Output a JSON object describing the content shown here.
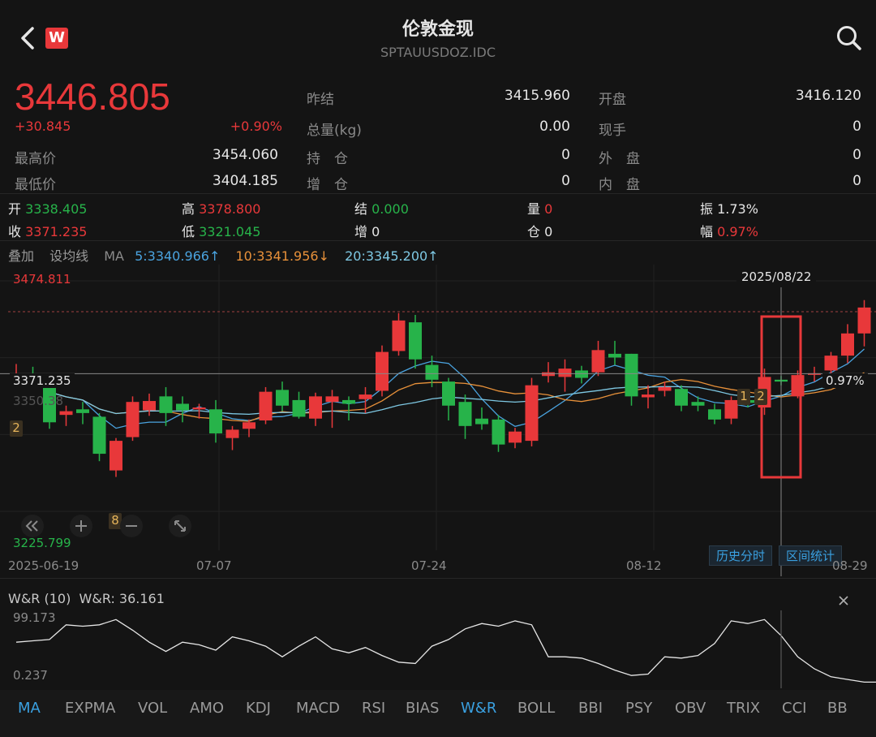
{
  "header": {
    "title": "伦敦金现",
    "subtitle": "SPTAUUSDOZ.IDC",
    "back_icon": "chevron-left-icon",
    "app_icon": "wps-logo-icon",
    "search_icon": "search-icon"
  },
  "quote": {
    "price": "3446.805",
    "change": "+30.845",
    "change_pct": "+0.90%",
    "prev_settle_label": "昨结",
    "prev_settle": "3415.960",
    "open_label": "开盘",
    "open": "3416.120",
    "volume_label": "总量(kg)",
    "volume": "0.00",
    "current_hand_label": "现手",
    "current_hand": "0",
    "high_label": "最高价",
    "high": "3454.060",
    "position_label": "持　仓",
    "position": "0",
    "outer_label": "外　盘",
    "outer": "0",
    "low_label": "最低价",
    "low": "3404.185",
    "increase_label": "增　仓",
    "increase": "0",
    "inner_label": "内　盘",
    "inner": "0"
  },
  "ohlc": {
    "open_label": "开",
    "open": "3338.405",
    "high_label": "高",
    "high": "3378.800",
    "settle_label": "结",
    "settle": "0.000",
    "vol_label": "量",
    "vol": "0",
    "amp_label": "振",
    "amp": "1.73%",
    "close_label": "收",
    "close": "3371.235",
    "low_label": "低",
    "low": "3321.045",
    "inc_label": "增",
    "inc": "0",
    "pos_label": "仓",
    "pos": "0",
    "range_label": "幅",
    "range": "0.97%"
  },
  "ma_bar": {
    "overlay": "叠加",
    "set_ma": "设均线",
    "ma": "MA",
    "ma5": "5:3340.966↑",
    "ma10": "10:3341.956↓",
    "ma20": "20:3345.200↑"
  },
  "chart_labels": {
    "max_price": "3474.811",
    "min_price": "3225.799",
    "crosshair_date": "2025/08/22",
    "crosshair_price": "3371.235",
    "crosshair_pct": "0.97%",
    "overlap_price": "3350.38",
    "badge_2_left": "2",
    "badge_8": "8",
    "badge_1": "1",
    "badge_2_right": "2",
    "history_btn": "历史分时",
    "stats_btn": "区间统计",
    "x_ticks": [
      "2025-06-19",
      "07-07",
      "07-24",
      "08-12",
      "08-29"
    ]
  },
  "colors": {
    "up": "#e8383a",
    "down": "#27b34a",
    "ma5": "#4aa3df",
    "ma10": "#e8913a",
    "ma20": "#7ec8e3",
    "accent": "#3aa0e0"
  },
  "chart_data": {
    "type": "candlestick",
    "ylim": [
      3225.799,
      3474.811
    ],
    "x": [
      "2025-06-19",
      "06-20",
      "06-23",
      "06-24",
      "06-25",
      "06-26",
      "06-27",
      "06-30",
      "07-01",
      "07-02",
      "07-03",
      "07-04",
      "07-07",
      "07-08",
      "07-09",
      "07-10",
      "07-11",
      "07-14",
      "07-15",
      "07-16",
      "07-17",
      "07-18",
      "07-21",
      "07-22",
      "07-23",
      "07-24",
      "07-25",
      "07-28",
      "07-29",
      "07-30",
      "07-31",
      "08-01",
      "08-04",
      "08-05",
      "08-06",
      "08-07",
      "08-08",
      "08-11",
      "08-12",
      "08-13",
      "08-14",
      "08-15",
      "08-18",
      "08-19",
      "08-20",
      "08-21",
      "08-22",
      "08-25",
      "08-26",
      "08-27",
      "08-28",
      "08-29"
    ],
    "candles": [
      {
        "o": 3368,
        "h": 3385,
        "l": 3360,
        "c": 3372
      },
      {
        "o": 3372,
        "h": 3382,
        "l": 3366,
        "c": 3370
      },
      {
        "o": 3360,
        "h": 3368,
        "l": 3315,
        "c": 3322
      },
      {
        "o": 3330,
        "h": 3340,
        "l": 3318,
        "c": 3334
      },
      {
        "o": 3336,
        "h": 3344,
        "l": 3320,
        "c": 3332
      },
      {
        "o": 3328,
        "h": 3332,
        "l": 3280,
        "c": 3288
      },
      {
        "o": 3270,
        "h": 3305,
        "l": 3263,
        "c": 3302
      },
      {
        "o": 3306,
        "h": 3350,
        "l": 3302,
        "c": 3344
      },
      {
        "o": 3335,
        "h": 3353,
        "l": 3329,
        "c": 3345
      },
      {
        "o": 3350,
        "h": 3360,
        "l": 3318,
        "c": 3332
      },
      {
        "o": 3342,
        "h": 3350,
        "l": 3322,
        "c": 3335
      },
      {
        "o": 3336,
        "h": 3342,
        "l": 3326,
        "c": 3338
      },
      {
        "o": 3336,
        "h": 3346,
        "l": 3300,
        "c": 3310
      },
      {
        "o": 3305,
        "h": 3318,
        "l": 3292,
        "c": 3314
      },
      {
        "o": 3315,
        "h": 3325,
        "l": 3306,
        "c": 3322
      },
      {
        "o": 3324,
        "h": 3360,
        "l": 3320,
        "c": 3355
      },
      {
        "o": 3357,
        "h": 3366,
        "l": 3334,
        "c": 3340
      },
      {
        "o": 3346,
        "h": 3355,
        "l": 3326,
        "c": 3328
      },
      {
        "o": 3326,
        "h": 3354,
        "l": 3318,
        "c": 3350
      },
      {
        "o": 3344,
        "h": 3357,
        "l": 3316,
        "c": 3350
      },
      {
        "o": 3346,
        "h": 3350,
        "l": 3324,
        "c": 3342
      },
      {
        "o": 3347,
        "h": 3360,
        "l": 3332,
        "c": 3352
      },
      {
        "o": 3356,
        "h": 3405,
        "l": 3350,
        "c": 3398
      },
      {
        "o": 3399,
        "h": 3440,
        "l": 3394,
        "c": 3432
      },
      {
        "o": 3430,
        "h": 3438,
        "l": 3380,
        "c": 3390
      },
      {
        "o": 3384,
        "h": 3394,
        "l": 3360,
        "c": 3368
      },
      {
        "o": 3366,
        "h": 3370,
        "l": 3324,
        "c": 3340
      },
      {
        "o": 3344,
        "h": 3352,
        "l": 3304,
        "c": 3318
      },
      {
        "o": 3326,
        "h": 3338,
        "l": 3314,
        "c": 3320
      },
      {
        "o": 3325,
        "h": 3330,
        "l": 3290,
        "c": 3298
      },
      {
        "o": 3300,
        "h": 3316,
        "l": 3294,
        "c": 3312
      },
      {
        "o": 3302,
        "h": 3370,
        "l": 3296,
        "c": 3362
      },
      {
        "o": 3372,
        "h": 3387,
        "l": 3365,
        "c": 3376
      },
      {
        "o": 3371,
        "h": 3390,
        "l": 3355,
        "c": 3380
      },
      {
        "o": 3378,
        "h": 3383,
        "l": 3364,
        "c": 3370
      },
      {
        "o": 3376,
        "h": 3410,
        "l": 3372,
        "c": 3400
      },
      {
        "o": 3396,
        "h": 3410,
        "l": 3384,
        "c": 3392
      },
      {
        "o": 3396,
        "h": 3396,
        "l": 3340,
        "c": 3350
      },
      {
        "o": 3349,
        "h": 3362,
        "l": 3337,
        "c": 3352
      },
      {
        "o": 3356,
        "h": 3366,
        "l": 3350,
        "c": 3360
      },
      {
        "o": 3358,
        "h": 3362,
        "l": 3334,
        "c": 3340
      },
      {
        "o": 3344,
        "h": 3350,
        "l": 3334,
        "c": 3340
      },
      {
        "o": 3336,
        "h": 3342,
        "l": 3320,
        "c": 3325
      },
      {
        "o": 3326,
        "h": 3350,
        "l": 3320,
        "c": 3346
      },
      {
        "o": 3346,
        "h": 3350,
        "l": 3338,
        "c": 3343
      },
      {
        "o": 3338,
        "h": 3380,
        "l": 3330,
        "c": 3371
      },
      {
        "o": 3368,
        "h": 3372,
        "l": 3362,
        "c": 3366
      },
      {
        "o": 3350,
        "h": 3378,
        "l": 3348,
        "c": 3373
      },
      {
        "o": 3374,
        "h": 3382,
        "l": 3366,
        "c": 3375
      },
      {
        "o": 3378,
        "h": 3398,
        "l": 3370,
        "c": 3394
      },
      {
        "o": 3394,
        "h": 3428,
        "l": 3386,
        "c": 3418
      },
      {
        "o": 3418,
        "h": 3454,
        "l": 3404,
        "c": 3446
      }
    ]
  },
  "wr": {
    "title": "W&R (10)",
    "value_label": "W&R: 36.161",
    "max": "99.173",
    "min": "0.237",
    "close_icon": "close-icon",
    "series": [
      62,
      64,
      66,
      88,
      86,
      88,
      96,
      80,
      62,
      48,
      62,
      58,
      50,
      70,
      64,
      56,
      40,
      56,
      70,
      52,
      46,
      54,
      42,
      32,
      30,
      56,
      66,
      82,
      90,
      86,
      94,
      88,
      40,
      40,
      38,
      30,
      20,
      12,
      14,
      40,
      38,
      42,
      60,
      94,
      90,
      96,
      72,
      40,
      22,
      10,
      6,
      2,
      2
    ]
  },
  "tabs": [
    "MA",
    "EXPMA",
    "VOL",
    "AMO",
    "KDJ",
    "MACD",
    "RSI",
    "BIAS",
    "W&R",
    "BOLL",
    "BBI",
    "PSY",
    "OBV",
    "TRIX",
    "CCI",
    "BB"
  ],
  "active_tabs": [
    "MA",
    "W&R"
  ]
}
